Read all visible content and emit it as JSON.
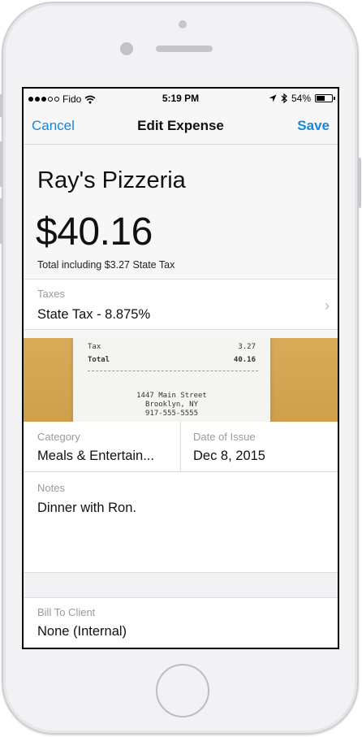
{
  "status_bar": {
    "carrier": "Fido",
    "time": "5:19 PM",
    "battery": "54%",
    "battery_level": 0.54,
    "signal_filled": 3,
    "signal_total": 5
  },
  "nav": {
    "cancel_label": "Cancel",
    "title": "Edit Expense",
    "save_label": "Save"
  },
  "expense": {
    "merchant": "Ray's Pizzeria",
    "amount": "$40.16",
    "total_note": "Total including $3.27 State Tax"
  },
  "taxes": {
    "label": "Taxes",
    "value": "State Tax - 8.875%"
  },
  "receipt": {
    "tax_label": "Tax",
    "tax_value": "3.27",
    "total_label": "Total",
    "total_value": "40.16",
    "address_line1": "1447 Main Street",
    "address_line2": "Brooklyn, NY",
    "phone": "917-555-5555"
  },
  "category": {
    "label": "Category",
    "value": "Meals & Entertain..."
  },
  "date": {
    "label": "Date of Issue",
    "value": "Dec 8, 2015"
  },
  "notes": {
    "label": "Notes",
    "value": "Dinner with Ron."
  },
  "billing": {
    "label": "Bill To Client",
    "value": "None (Internal)"
  },
  "colors": {
    "accent": "#1a86d6",
    "label_gray": "#9a9a9a"
  }
}
